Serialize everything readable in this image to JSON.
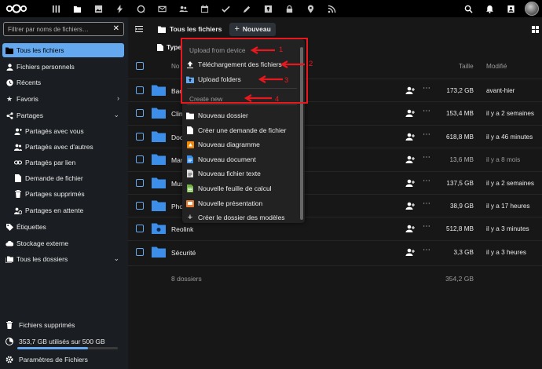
{
  "topbar": {
    "apps": [
      "dashboard-icon",
      "files-icon",
      "photos-icon",
      "activity-icon",
      "talk-icon",
      "mail-icon",
      "contacts-icon",
      "calendar-icon",
      "tasks-icon",
      "notes-icon",
      "passwords-icon",
      "lock-icon",
      "maps-icon",
      "news-icon"
    ],
    "right": [
      "search-icon",
      "notifications-icon",
      "contacts-menu-icon"
    ]
  },
  "sidebar": {
    "filter_placeholder": "Filtrer par noms de fichiers…",
    "items": [
      {
        "label": "Tous les fichiers",
        "icon": "folder-icon"
      },
      {
        "label": "Fichiers personnels",
        "icon": "user-icon"
      },
      {
        "label": "Récents",
        "icon": "clock-icon"
      },
      {
        "label": "Favoris",
        "icon": "star-icon"
      },
      {
        "label": "Partages",
        "icon": "share-icon"
      },
      {
        "label": "Partagés avec vous",
        "icon": "user-add-icon"
      },
      {
        "label": "Partagés avec d'autres",
        "icon": "user-group-icon"
      },
      {
        "label": "Partagés par lien",
        "icon": "link-icon"
      },
      {
        "label": "Demande de fichier",
        "icon": "file-upload-icon"
      },
      {
        "label": "Partages supprimés",
        "icon": "trash-icon"
      },
      {
        "label": "Partages en attente",
        "icon": "pending-icon"
      },
      {
        "label": "Étiquettes",
        "icon": "tag-icon"
      },
      {
        "label": "Stockage externe",
        "icon": "cloud-icon"
      },
      {
        "label": "Tous les dossiers",
        "icon": "folders-icon"
      }
    ],
    "bottom": {
      "trash": "Fichiers supprimés",
      "quota": "353,7 GB utilisés sur 500 GB",
      "quota_fraction": 0.707,
      "settings": "Paramètres de Fichiers"
    }
  },
  "main": {
    "breadcrumb": "Tous les fichiers",
    "new_button": "Nouveau",
    "filter_type": "Type",
    "col_name": "No",
    "col_size": "Taille",
    "col_modified": "Modifié",
    "rows": [
      {
        "name": "Bac",
        "size": "173,2 GB",
        "modified": "avant-hier",
        "dim": false
      },
      {
        "name": "Clin",
        "size": "153,4 MB",
        "modified": "il y a 2 semaines",
        "dim": false
      },
      {
        "name": "Doc",
        "size": "618,8 MB",
        "modified": "il y a 46 minutes",
        "dim": false
      },
      {
        "name": "Mar",
        "size": "13,6 MB",
        "modified": "il y a 8 mois",
        "dim": true
      },
      {
        "name": "Mus",
        "size": "137,5 GB",
        "modified": "il y a 2 semaines",
        "dim": false
      },
      {
        "name": "Pho",
        "size": "38,9 GB",
        "modified": "il y a 17 heures",
        "dim": false
      },
      {
        "name": "Reolink",
        "size": "512,8 MB",
        "modified": "il y a 3 minutes",
        "dim": false
      },
      {
        "name": "Sécurité",
        "size": "3,3 GB",
        "modified": "il y a 3 heures",
        "dim": false
      }
    ],
    "summary_count": "8 dossiers",
    "summary_size": "354,2 GB"
  },
  "menu": {
    "caption_upload": "Upload from device",
    "upload_files": "Téléchargement des fichiers",
    "upload_folders": "Upload folders",
    "caption_create": "Create new",
    "create_items": [
      {
        "label": "Nouveau dossier",
        "icon": "folder-icon"
      },
      {
        "label": "Créer une demande de fichier",
        "icon": "file-request-icon"
      },
      {
        "label": "Nouveau diagramme",
        "icon": "diagram-icon"
      },
      {
        "label": "Nouveau document",
        "icon": "document-icon"
      },
      {
        "label": "Nouveau fichier texte",
        "icon": "text-file-icon"
      },
      {
        "label": "Nouvelle feuille de calcul",
        "icon": "spreadsheet-icon"
      },
      {
        "label": "Nouvelle présentation",
        "icon": "presentation-icon"
      },
      {
        "label": "Créer le dossier des modèles",
        "icon": "plus-icon"
      }
    ]
  },
  "annotations": [
    "1",
    "2",
    "3",
    "4"
  ],
  "colors": {
    "accent": "#64a9f0",
    "annotation": "#e8191e",
    "background": "#171717",
    "sidebar": "#1a1d21"
  }
}
